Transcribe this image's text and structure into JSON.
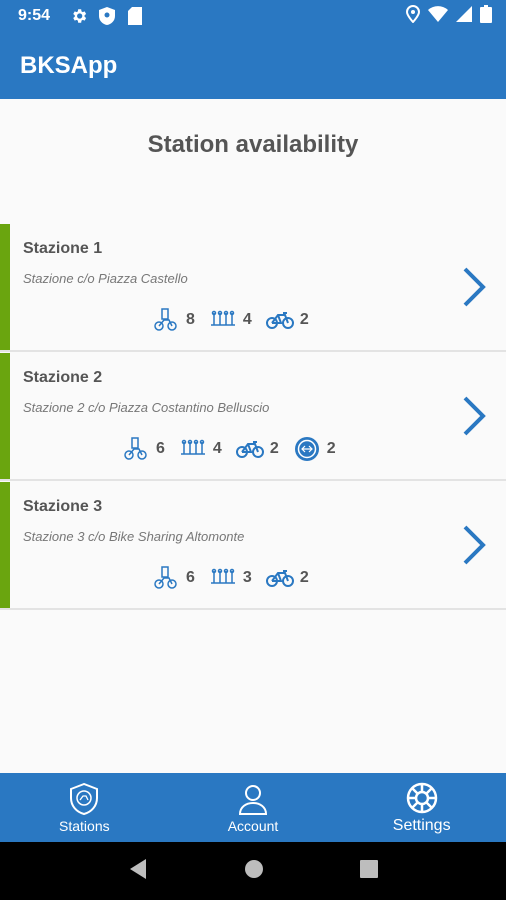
{
  "status": {
    "time": "9:54"
  },
  "app": {
    "title": "BKSApp"
  },
  "page": {
    "title": "Station availability"
  },
  "colors": {
    "primary": "#2a78c2",
    "available": "#6aa50f"
  },
  "stations": [
    {
      "name": "Stazione 1",
      "address": "Stazione c/o Piazza Castello",
      "stats": [
        {
          "icon": "bike-dock-icon",
          "value": "8"
        },
        {
          "icon": "slots-icon",
          "value": "4"
        },
        {
          "icon": "bicycle-icon",
          "value": "2"
        }
      ]
    },
    {
      "name": "Stazione 2",
      "address": "Stazione 2 c/o Piazza Costantino Belluscio",
      "stats": [
        {
          "icon": "bike-dock-icon",
          "value": "6"
        },
        {
          "icon": "slots-icon",
          "value": "4"
        },
        {
          "icon": "bicycle-icon",
          "value": "2"
        },
        {
          "icon": "e-bike-icon",
          "value": "2"
        }
      ]
    },
    {
      "name": "Stazione 3",
      "address": "Stazione 3 c/o Bike Sharing Altomonte",
      "stats": [
        {
          "icon": "bike-dock-icon",
          "value": "6"
        },
        {
          "icon": "slots-icon",
          "value": "3"
        },
        {
          "icon": "bicycle-icon",
          "value": "2"
        }
      ]
    }
  ],
  "nav": {
    "stations": "Stations",
    "account": "Account",
    "settings": "Settings"
  }
}
